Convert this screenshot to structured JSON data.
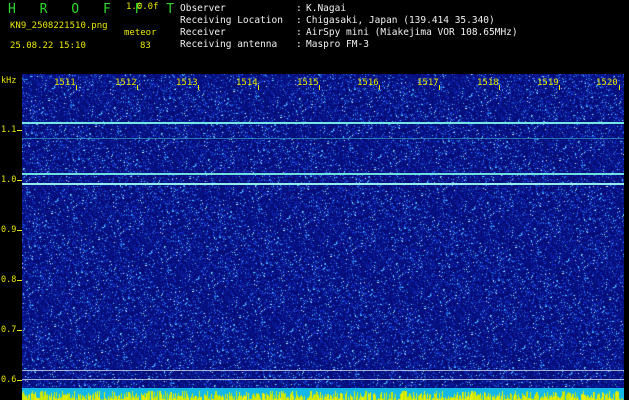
{
  "header": {
    "app_title": "H R O F F T",
    "version": "1.0.0f",
    "file_name": "KN9_2508221510.png",
    "meteor_label": "meteor",
    "meteor_count": "83",
    "datetime": "25.08.22 15:10"
  },
  "info": [
    {
      "label": "Observer",
      "value": "K.Nagai"
    },
    {
      "label": "Receiving Location",
      "value": "Chigasaki, Japan (139.414 35.340)"
    },
    {
      "label": "Receiver",
      "value": "AirSpy mini (Miakejima VOR 108.65MHz)"
    },
    {
      "label": "Receiving antenna",
      "value": "Maspro FM-3"
    }
  ],
  "axes": {
    "y_unit": "kHz",
    "y_labels": [
      "1.1",
      "1.0",
      "0.9",
      "0.8",
      "0.7",
      "0.6"
    ],
    "x_labels": [
      "1511",
      "1512",
      "1513",
      "1514",
      "1515",
      "1516",
      "1517",
      "1518",
      "1519",
      "1520"
    ]
  },
  "colors": {
    "accent_yellow": "#e8e800",
    "title_green": "#2bd82b",
    "background_blue": "#06086e",
    "signal_cyan": "#6ef0e8"
  }
}
